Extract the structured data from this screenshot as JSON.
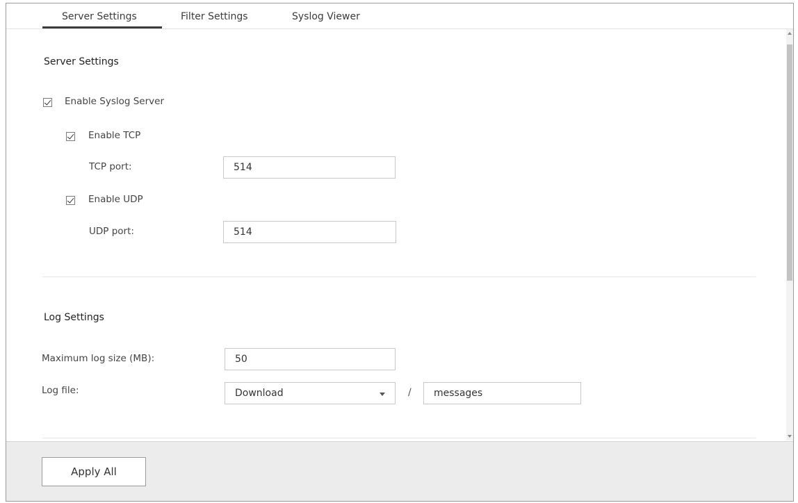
{
  "tabs": [
    {
      "label": "Server Settings",
      "active": true
    },
    {
      "label": "Filter Settings",
      "active": false
    },
    {
      "label": "Syslog Viewer",
      "active": false
    }
  ],
  "server_settings": {
    "heading": "Server Settings",
    "enable_syslog": {
      "label": "Enable Syslog Server",
      "checked": true
    },
    "enable_tcp": {
      "label": "Enable TCP",
      "checked": true
    },
    "tcp_port": {
      "label": "TCP port:",
      "value": "514"
    },
    "enable_udp": {
      "label": "Enable UDP",
      "checked": true
    },
    "udp_port": {
      "label": "UDP port:",
      "value": "514"
    }
  },
  "log_settings": {
    "heading": "Log Settings",
    "max_log_size": {
      "label": "Maximum log size (MB):",
      "value": "50"
    },
    "log_file": {
      "label": "Log file:",
      "folder": "Download",
      "separator": "/",
      "filename": "messages"
    }
  },
  "footer": {
    "apply_label": "Apply All"
  }
}
